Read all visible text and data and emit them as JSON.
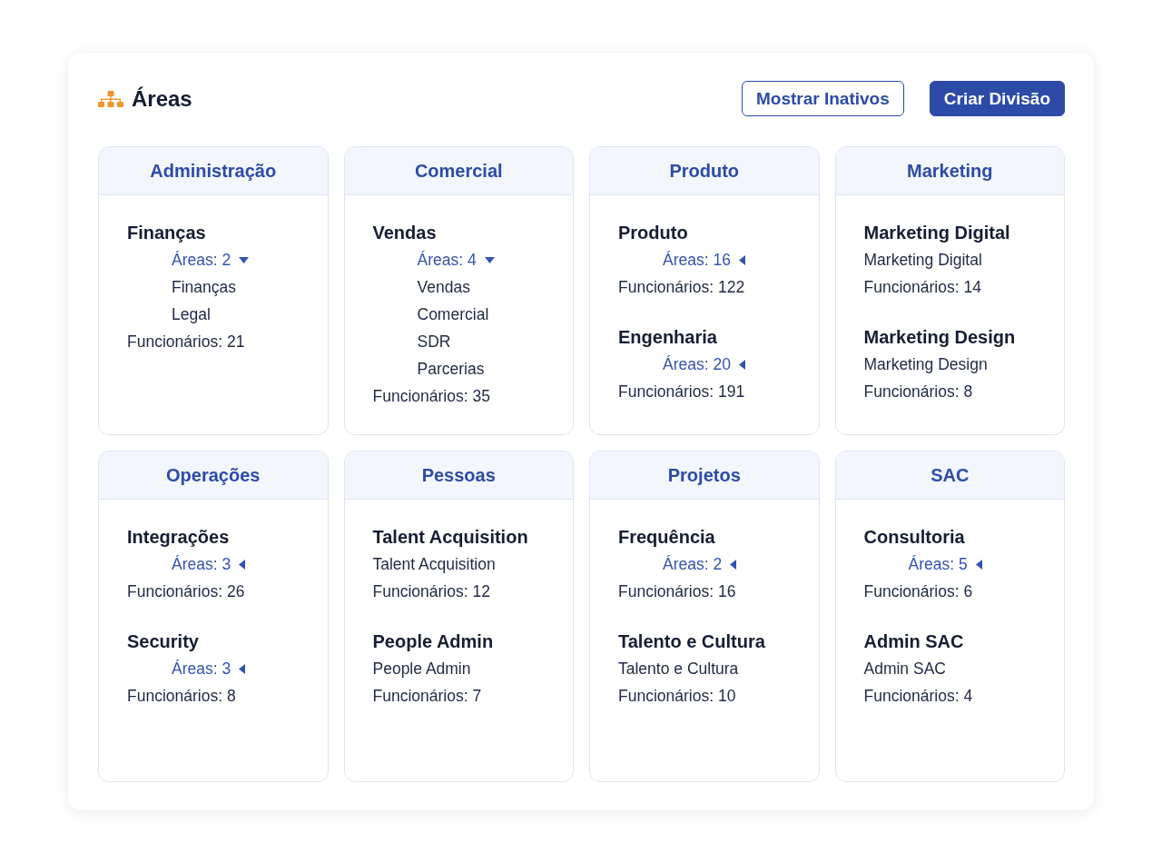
{
  "header": {
    "title": "Áreas",
    "buttons": [
      {
        "label": "Mostrar Inativos",
        "kind": "outline"
      },
      {
        "label": "Criar Divisão",
        "kind": "primary"
      }
    ]
  },
  "divisions": [
    {
      "title": "Administração",
      "groups": [
        {
          "name": "Finanças",
          "kind": "areas",
          "areas_label": "Áreas: 2",
          "expanded": true,
          "areas": [
            "Finanças",
            "Legal"
          ],
          "employees": "Funcionários: 21"
        }
      ]
    },
    {
      "title": "Comercial",
      "groups": [
        {
          "name": "Vendas",
          "kind": "areas",
          "areas_label": "Áreas: 4",
          "expanded": true,
          "areas": [
            "Vendas",
            "Comercial",
            "SDR",
            "Parcerias"
          ],
          "employees": "Funcionários: 35"
        }
      ]
    },
    {
      "title": "Produto",
      "groups": [
        {
          "name": "Produto",
          "kind": "areas",
          "areas_label": "Áreas: 16",
          "expanded": false,
          "employees": "Funcionários: 122"
        },
        {
          "name": "Engenharia",
          "kind": "areas",
          "areas_label": "Áreas: 20",
          "expanded": false,
          "employees": "Funcionários: 191"
        }
      ]
    },
    {
      "title": "Marketing",
      "groups": [
        {
          "name": "Marketing Digital",
          "kind": "plain",
          "subtitle": "Marketing Digital",
          "employees": "Funcionários: 14"
        },
        {
          "name": "Marketing Design",
          "kind": "plain",
          "subtitle": "Marketing Design",
          "employees": "Funcionários: 8"
        }
      ]
    },
    {
      "title": "Operações",
      "groups": [
        {
          "name": "Integrações",
          "kind": "areas",
          "areas_label": "Áreas: 3",
          "expanded": false,
          "employees": "Funcionários: 26"
        },
        {
          "name": "Security",
          "kind": "areas",
          "areas_label": "Áreas: 3",
          "expanded": false,
          "employees": "Funcionários: 8"
        }
      ]
    },
    {
      "title": "Pessoas",
      "groups": [
        {
          "name": "Talent Acquisition",
          "kind": "plain",
          "subtitle": "Talent Acquisition",
          "employees": "Funcionários: 12"
        },
        {
          "name": "People Admin",
          "kind": "plain",
          "subtitle": "People Admin",
          "employees": "Funcionários: 7"
        }
      ]
    },
    {
      "title": "Projetos",
      "groups": [
        {
          "name": "Frequência",
          "kind": "areas",
          "areas_label": "Áreas: 2",
          "expanded": false,
          "employees": "Funcionários: 16"
        },
        {
          "name": "Talento e Cultura",
          "kind": "plain",
          "subtitle": "Talento e Cultura",
          "employees": "Funcionários: 10"
        }
      ]
    },
    {
      "title": "SAC",
      "groups": [
        {
          "name": "Consultoria",
          "kind": "areas",
          "areas_label": "Áreas: 5",
          "expanded": false,
          "employees": "Funcionários: 6"
        },
        {
          "name": "Admin SAC",
          "kind": "plain",
          "subtitle": "Admin SAC",
          "employees": "Funcionários: 4"
        }
      ]
    }
  ]
}
